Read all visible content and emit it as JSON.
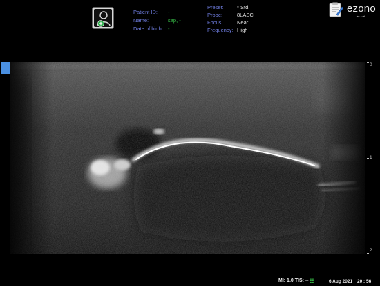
{
  "header": {
    "patient": [
      {
        "label": "Patient ID:",
        "value": "-"
      },
      {
        "label": "Name:",
        "value": "sap, -"
      },
      {
        "label": "Date of birth:",
        "value": "-"
      }
    ],
    "settings": [
      {
        "label": "Preset:",
        "value": "* Std."
      },
      {
        "label": "Probe:",
        "value": "8LASC"
      },
      {
        "label": "Focus:",
        "value": "Near"
      },
      {
        "label": "Frequency:",
        "value": "High"
      }
    ],
    "brand": "ezono",
    "icons": [
      "patient-icon",
      "report-clipboard-icon"
    ]
  },
  "image": {
    "depth_labels": [
      "0",
      "1",
      "2"
    ],
    "depth_levels": [
      0,
      1,
      2
    ]
  },
  "footer": {
    "mi_tis": "MI: 1.0 TIS: --",
    "date": "6 Aug 2021",
    "time": "20 : 56"
  },
  "colors": {
    "label": "#6f7de0",
    "patient_value": "#39c24a",
    "selection_marker": "#4a8fe0"
  }
}
